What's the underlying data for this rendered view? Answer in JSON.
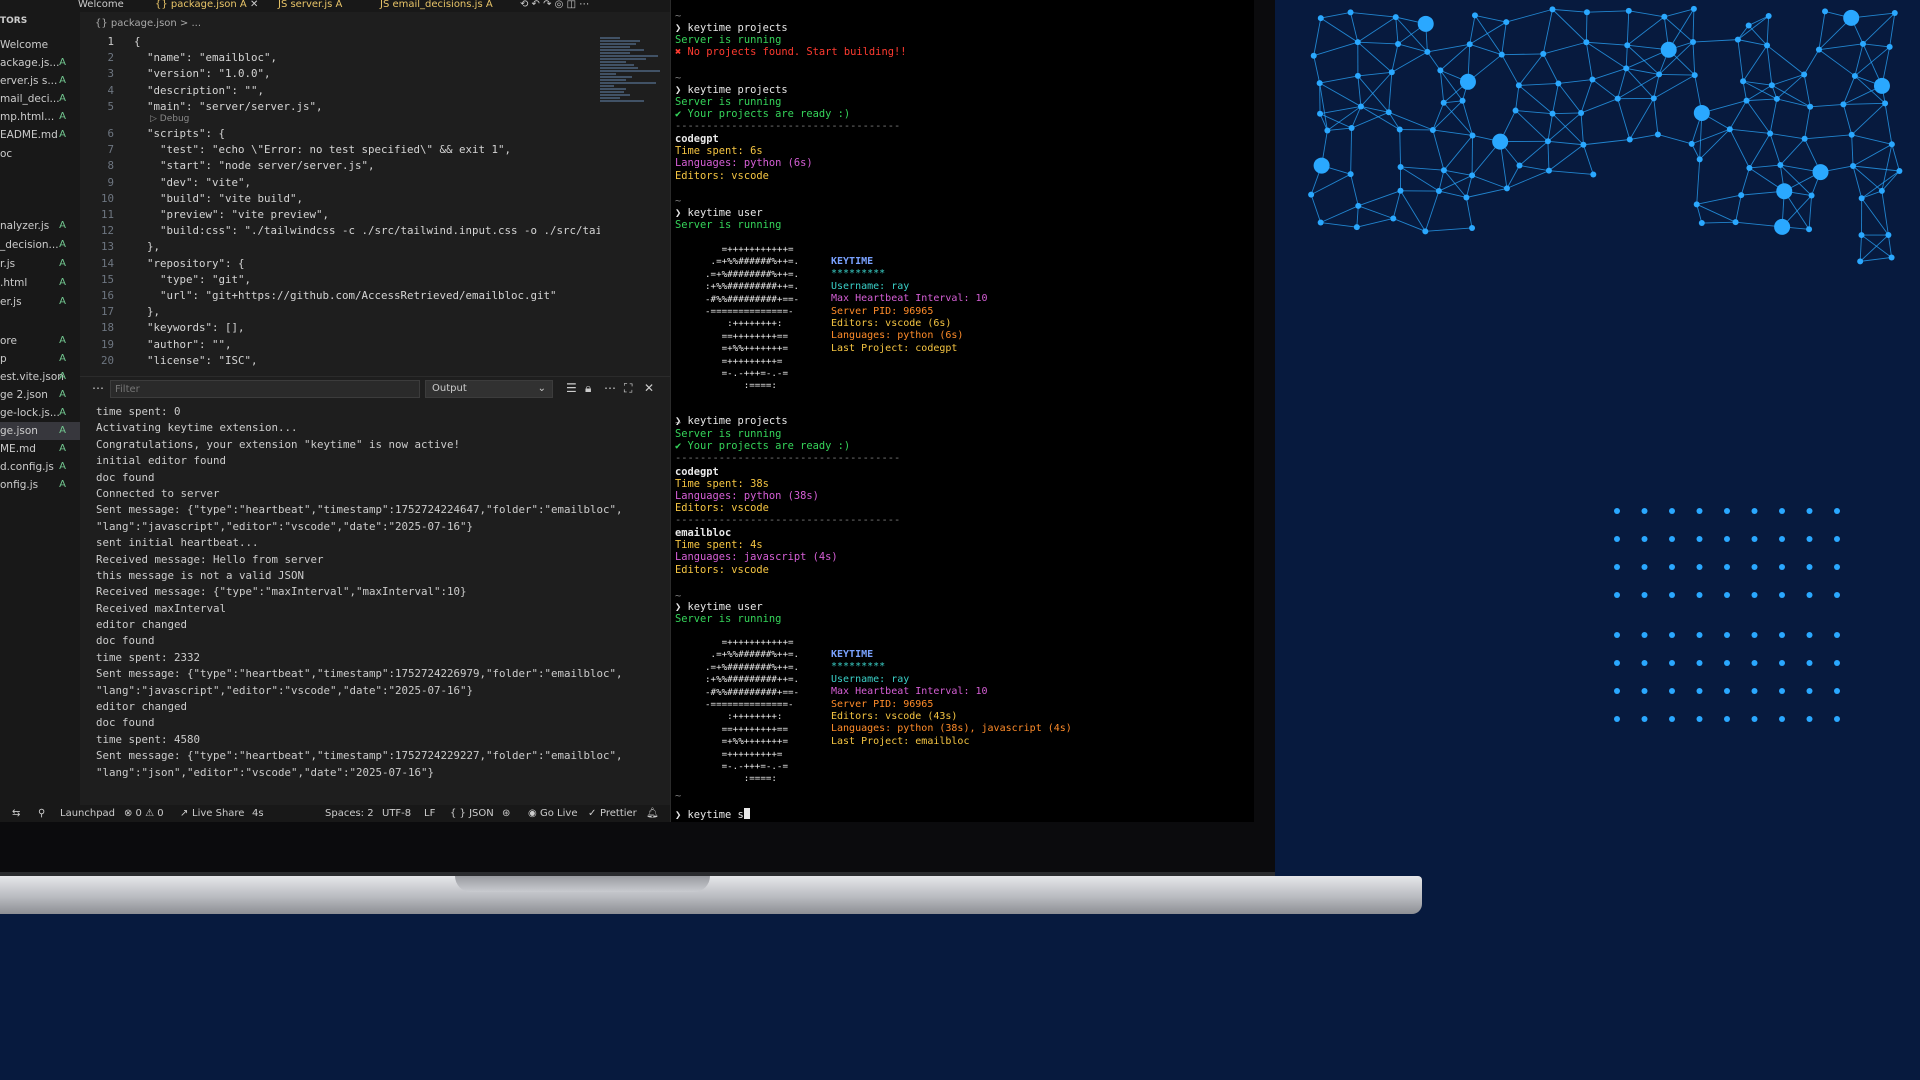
{
  "tabs": [
    {
      "label": "Welcome"
    },
    {
      "label": "{} package.json A"
    },
    {
      "label": "JS server.js A"
    },
    {
      "label": "JS email_decisions.js A"
    }
  ],
  "explorer": {
    "section_label": "TORS",
    "items": [
      {
        "name": "Welcome",
        "status": ""
      },
      {
        "name": "ackage.js...",
        "status": "A"
      },
      {
        "name": "erver.js s...",
        "status": "A"
      },
      {
        "name": "mail_deci...",
        "status": "A"
      },
      {
        "name": "mp.html...",
        "status": "A"
      },
      {
        "name": "EADME.md",
        "status": "A"
      },
      {
        "name": "oc",
        "status": ""
      },
      {
        "name": "",
        "status": ""
      },
      {
        "name": "",
        "status": ""
      },
      {
        "name": "",
        "status": ""
      },
      {
        "name": "nalyzer.js",
        "status": "A"
      },
      {
        "name": "_decision...",
        "status": "A"
      },
      {
        "name": "r.js",
        "status": "A"
      },
      {
        "name": ".html",
        "status": "A"
      },
      {
        "name": "er.js",
        "status": "A"
      },
      {
        "name": "",
        "status": ""
      },
      {
        "name": "ore",
        "status": "A"
      },
      {
        "name": "p",
        "status": "A"
      },
      {
        "name": "est.vite.json",
        "status": "A"
      },
      {
        "name": "ge 2.json",
        "status": "A"
      },
      {
        "name": "ge-lock.js...",
        "status": "A"
      },
      {
        "name": "ge.json",
        "status": "A"
      },
      {
        "name": "ME.md",
        "status": "A"
      },
      {
        "name": "d.config.js",
        "status": "A"
      },
      {
        "name": "onfig.js",
        "status": "A"
      }
    ]
  },
  "breadcrumb": "{} package.json > ...",
  "editor": {
    "codelens": "▷ Debug",
    "lines": [
      {
        "n": "1",
        "t": "{"
      },
      {
        "n": "2",
        "t": "  \"name\": \"emailbloc\","
      },
      {
        "n": "3",
        "t": "  \"version\": \"1.0.0\","
      },
      {
        "n": "4",
        "t": "  \"description\": \"\","
      },
      {
        "n": "5",
        "t": "  \"main\": \"server/server.js\","
      },
      {
        "n": "6",
        "t": "  \"scripts\": {"
      },
      {
        "n": "7",
        "t": "    \"test\": \"echo \\\"Error: no test specified\\\" && exit 1\","
      },
      {
        "n": "8",
        "t": "    \"start\": \"node server/server.js\","
      },
      {
        "n": "9",
        "t": "    \"dev\": \"vite\","
      },
      {
        "n": "10",
        "t": "    \"build\": \"vite build\","
      },
      {
        "n": "11",
        "t": "    \"preview\": \"vite preview\","
      },
      {
        "n": "12",
        "t": "    \"build:css\": \"./tailwindcss -c ./src/tailwind.input.css -o ./src/tail"
      },
      {
        "n": "13",
        "t": "  },"
      },
      {
        "n": "14",
        "t": "  \"repository\": {"
      },
      {
        "n": "15",
        "t": "    \"type\": \"git\","
      },
      {
        "n": "16",
        "t": "    \"url\": \"git+https://github.com/AccessRetrieved/emailbloc.git\""
      },
      {
        "n": "17",
        "t": "  },"
      },
      {
        "n": "18",
        "t": "  \"keywords\": [],"
      },
      {
        "n": "19",
        "t": "  \"author\": \"\","
      },
      {
        "n": "20",
        "t": "  \"license\": \"ISC\","
      }
    ]
  },
  "panel": {
    "filter_placeholder": "Filter",
    "output_channel": "Output",
    "lines": [
      "time spent: 0",
      "Activating keytime extension...",
      "Congratulations, your extension \"keytime\" is now active!",
      "initial editor found",
      "doc found",
      "Connected to server",
      "Sent message: {\"type\":\"heartbeat\",\"timestamp\":1752724224647,\"folder\":\"emailbloc\",",
      "\"lang\":\"javascript\",\"editor\":\"vscode\",\"date\":\"2025-07-16\"}",
      "sent initial heartbeat...",
      "Received message: Hello from server",
      "this message is not a valid JSON",
      "Received message: {\"type\":\"maxInterval\",\"maxInterval\":10}",
      "Received maxInterval",
      "editor changed",
      "doc found",
      "time spent: 2332",
      "Sent message: {\"type\":\"heartbeat\",\"timestamp\":1752724226979,\"folder\":\"emailbloc\",",
      "\"lang\":\"javascript\",\"editor\":\"vscode\",\"date\":\"2025-07-16\"}",
      "editor changed",
      "doc found",
      "time spent: 4580",
      "Sent message: {\"type\":\"heartbeat\",\"timestamp\":1752724229227,\"folder\":\"emailbloc\",",
      "\"lang\":\"json\",\"editor\":\"vscode\",\"date\":\"2025-07-16\"}"
    ]
  },
  "statusbar": {
    "launchpad": "Launchpad",
    "problems": "⊗ 0 ⚠ 0",
    "liveshare": "Live Share",
    "time": "4s",
    "spaces": "Spaces: 2",
    "encoding": "UTF-8",
    "eol": "LF",
    "language": "{ } JSON",
    "golive": "Go Live",
    "prettier": "Prettier"
  },
  "terminal": {
    "prompt": "❯ keytime projects",
    "prompt_user": "❯ keytime user",
    "server_running": "Server is running",
    "no_projects": "✖ No projects found. Start building!!",
    "ready": "✔ Your projects are ready :)",
    "separator": "------------------------------------",
    "tilde": "~",
    "block1": {
      "project": "codegpt",
      "time": "Time spent: 6s",
      "langs": "Languages: python (6s)",
      "editors": "Editors: vscode"
    },
    "block2": {
      "project": "codegpt",
      "time": "Time spent: 38s",
      "langs": "Languages: python (38s)",
      "editors": "Editors: vscode"
    },
    "block3": {
      "project": "emailbloc",
      "time": "Time spent: 4s",
      "langs": "Languages: javascript (4s)",
      "editors": "Editors: vscode"
    },
    "art": [
      "   =+++++++++++=",
      " .=+%%######%++=.",
      ".=+%########%++=.",
      ":+%%#########++=.",
      "-#%%#########+==-",
      "-==============-",
      "    :++++++++:",
      "   ==++++++++==",
      "   =+%%+++++++=",
      "   =+++++++++=",
      "   =-.-+++=-.-=",
      "       :====:"
    ],
    "info1": {
      "title": "KEYTIME",
      "stars": "*********",
      "username": "Username: ray",
      "heartbeat": "Max Heartbeat Interval: 10",
      "pid": "Server PID: 96965",
      "editors": "Editors: vscode (6s)",
      "languages": "Languages: python (6s)",
      "last": "Last Project: codegpt"
    },
    "info2": {
      "title": "KEYTIME",
      "stars": "*********",
      "username": "Username: ray",
      "heartbeat": "Max Heartbeat Interval: 10",
      "pid": "Server PID: 96965",
      "editors": "Editors: vscode (43s)",
      "languages": "Languages: python (38s), javascript (4s)",
      "last": "Last Project: emailbloc"
    },
    "current_input": "❯ keytime s"
  },
  "colors": {
    "background": "#071a3e",
    "accent": "#2aa8ff"
  }
}
